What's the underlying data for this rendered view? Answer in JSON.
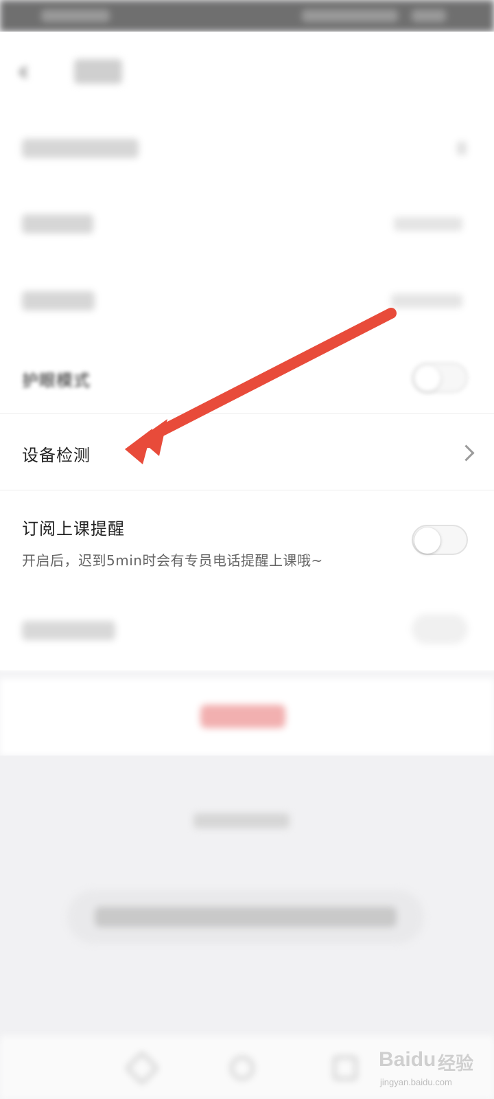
{
  "rows": {
    "eye_mode_label": "护眼模式",
    "device_check_label": "设备检测",
    "reminder_title": "订阅上课提醒",
    "reminder_subtitle": "开启后，迟到5min时会有专员电话提醒上课哦~"
  },
  "toggles": {
    "eye_mode_on": false,
    "reminder_on": false
  },
  "watermark": {
    "brand": "Bai",
    "brand2": "du",
    "cn": "经验",
    "url": "jingyan.baidu.com"
  },
  "colors": {
    "accent_red": "#e84b3a",
    "logout_red": "#f05a5a"
  },
  "icons": {
    "back": "chevron-left-icon",
    "chevron": "chevron-right-icon",
    "annotation": "red-arrow-icon"
  }
}
